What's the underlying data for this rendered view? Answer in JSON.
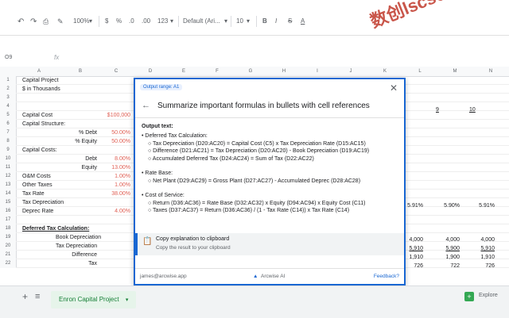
{
  "toolbar": {
    "zoom": "100%",
    "currency": "$",
    "percent": "%",
    "decimals_dec": ".0",
    "decimals_inc": ".00",
    "number_format": "123",
    "font": "Default (Ari...",
    "font_size": "10",
    "bold": "B",
    "italic": "I",
    "strike": "S",
    "text_color": "A"
  },
  "formula_bar": {
    "cell_ref": "O9",
    "fx": "fx"
  },
  "columns": [
    "A",
    "B",
    "C",
    "D",
    "E",
    "F",
    "G",
    "H",
    "I",
    "J",
    "K",
    "L",
    "M",
    "N"
  ],
  "rows": [
    {
      "n": "1",
      "a": "Capital Project",
      "b": "",
      "c": ""
    },
    {
      "n": "2",
      "a": "$ in Thousands",
      "b": "",
      "c": ""
    },
    {
      "n": "3",
      "a": "",
      "b": "",
      "c": ""
    },
    {
      "n": "4",
      "a": "",
      "b": "",
      "c": ""
    },
    {
      "n": "5",
      "a": "Capital Cost",
      "b": "",
      "c": "$100,000"
    },
    {
      "n": "6",
      "a": "Capital Structure:",
      "b": "",
      "c": ""
    },
    {
      "n": "7",
      "a": "",
      "b": "% Debt",
      "c": "50.00%"
    },
    {
      "n": "8",
      "a": "",
      "b": "% Equity",
      "c": "50.00%"
    },
    {
      "n": "9",
      "a": "Capital Costs:",
      "b": "",
      "c": ""
    },
    {
      "n": "10",
      "a": "",
      "b": "Debt",
      "c": "8.00%"
    },
    {
      "n": "11",
      "a": "",
      "b": "Equity",
      "c": "13.00%"
    },
    {
      "n": "12",
      "a": "O&M Costs",
      "b": "",
      "c": "1.00%"
    },
    {
      "n": "13",
      "a": "Other Taxes",
      "b": "",
      "c": "1.00%"
    },
    {
      "n": "14",
      "a": "Tax Rate",
      "b": "",
      "c": "38.00%"
    },
    {
      "n": "15",
      "a": "Tax Depreciation",
      "b": "",
      "c": ""
    },
    {
      "n": "16",
      "a": "Deprec Rate",
      "b": "",
      "c": "4.00%"
    },
    {
      "n": "17",
      "a": "",
      "b": "",
      "c": ""
    },
    {
      "n": "18",
      "a": "Deferred Tax Calculation:",
      "b": "",
      "c": ""
    },
    {
      "n": "19",
      "a": "",
      "b": "Book Depreciation",
      "c": ""
    },
    {
      "n": "20",
      "a": "",
      "b": "Tax Depreciation",
      "c": ""
    },
    {
      "n": "21",
      "a": "",
      "b": "Difference",
      "c": ""
    },
    {
      "n": "22",
      "a": "",
      "b": "Tax",
      "c": ""
    }
  ],
  "right_headers": [
    "9",
    "10"
  ],
  "right_values": {
    "row15": [
      "5.91%",
      "5.90%",
      "5.91%"
    ],
    "row19": [
      "4,000",
      "4,000",
      "4,000"
    ],
    "row20": [
      "5,910",
      "5,900",
      "5,910"
    ],
    "row21": [
      "1,910",
      "1,900",
      "1,910"
    ],
    "row22": [
      "726",
      "722",
      "726"
    ]
  },
  "modal": {
    "badge": "Output range: A1",
    "title": "Summarize important formulas in bullets with cell references",
    "output_label": "Output text:",
    "sections": [
      {
        "heading": "• Deferred Tax Calculation:",
        "items": [
          "○ Tax Depreciation (D20:AC20) = Capital Cost (C5) x Tax Depreciation Rate (D15:AC15)",
          "○ Difference (D21:AC21) = Tax Depreciation (D20:AC20) - Book Depreciation (D19:AC19)",
          "○ Accumulated Deferred Tax (D24:AC24) = Sum of Tax (D22:AC22)"
        ]
      },
      {
        "heading": "• Rate Base:",
        "items": [
          "○ Net Plant (D29:AC29) = Gross Plant (D27:AC27) - Accumulated Deprec (D28:AC28)"
        ]
      },
      {
        "heading": "• Cost of Service:",
        "items": [
          "○ Return (D36:AC36) = Rate Base (D32:AC32) x Equity (D94:AC94) x Equity Cost (C11)",
          "○ Taxes (D37:AC37) = Return (D36:AC36) / (1 - Tax Rate (C14)) x Tax Rate (C14)"
        ]
      }
    ],
    "copy_title": "Copy explanation to clipboard",
    "copy_sub": "Copy the result to your clipboard",
    "email": "james@arcwise.app",
    "brand": "Arcwise AI",
    "feedback": "Feedback?"
  },
  "bottom": {
    "add": "+",
    "sheets_menu": "≡",
    "sheet_tab": "Enron Capital Project",
    "explore": "Explore"
  },
  "watermark": "数创lscs66",
  "colors": {
    "accent": "#1967d2",
    "red_text": "#e06055",
    "sheet_tab_green": "#188038"
  }
}
